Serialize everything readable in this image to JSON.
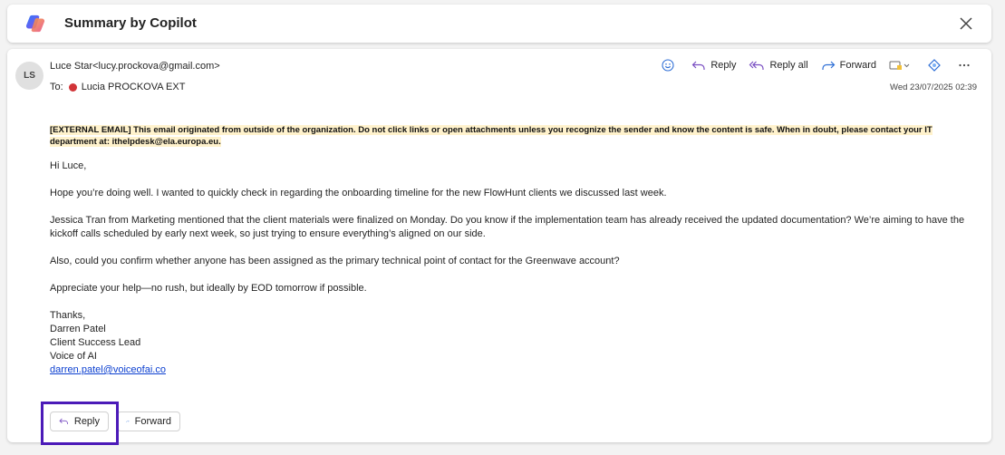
{
  "copilot": {
    "title": "Summary by Copilot"
  },
  "email": {
    "avatar_initials": "LS",
    "from": "Luce Star<lucy.prockova@gmail.com>",
    "to_label": "To:",
    "to_name": "Lucia PROCKOVA EXT",
    "timestamp": "Wed 23/07/2025 02:39",
    "actions": {
      "reply": "Reply",
      "reply_all": "Reply all",
      "forward": "Forward"
    },
    "warning_tag": "[EXTERNAL EMAIL]",
    "warning_text": " This email originated from outside of the organization. Do not click links or open attachments unless you recognize the sender and know the content is safe. When in doubt, please contact your IT department at: ithelpdesk@ela.europa.eu.",
    "greeting": "Hi Luce,",
    "paragraphs": [
      "Hope you’re doing well. I wanted to quickly check in regarding the onboarding timeline for the new FlowHunt clients we discussed last week.",
      "Jessica Tran from Marketing mentioned that the client materials were finalized on Monday. Do you know if the implementation team has already received the updated documentation? We’re aiming to have the kickoff calls scheduled by early next week, so just trying to ensure everything’s aligned on our side.",
      "Also, could you confirm whether anyone has been assigned as the primary technical point of contact for the Greenwave account?",
      "Appreciate your help—no rush, but ideally by EOD tomorrow if possible."
    ],
    "signature": {
      "closing": "Thanks,",
      "name": "Darren Patel",
      "role": "Client Success Lead",
      "company": "Voice of AI",
      "email": "darren.patel@voiceofai.co"
    },
    "bottom_buttons": {
      "reply": "Reply",
      "forward": "Forward"
    }
  },
  "colors": {
    "highlight_box": "#4b1ab8",
    "warning_bg": "#fff2cc",
    "link": "#0b3fd0",
    "recipient_dot": "#d13438"
  }
}
